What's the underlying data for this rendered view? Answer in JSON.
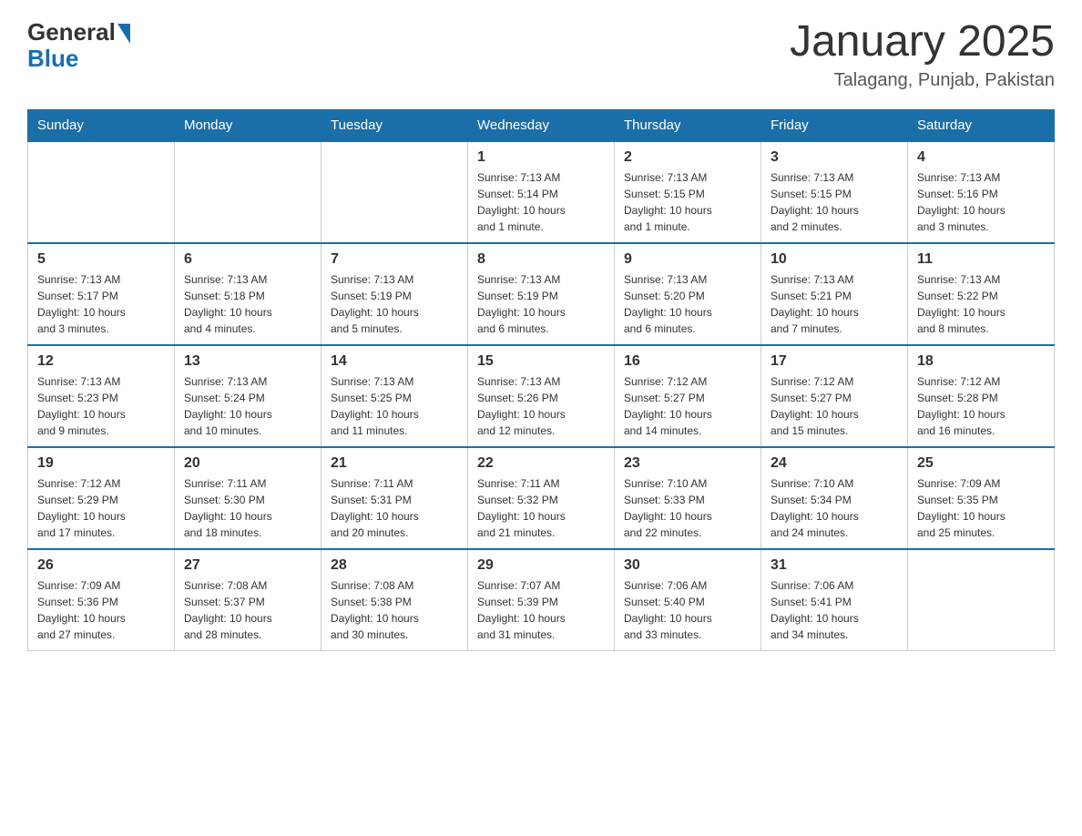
{
  "header": {
    "logo_general": "General",
    "logo_blue": "Blue",
    "month_title": "January 2025",
    "location": "Talagang, Punjab, Pakistan"
  },
  "weekdays": [
    "Sunday",
    "Monday",
    "Tuesday",
    "Wednesday",
    "Thursday",
    "Friday",
    "Saturday"
  ],
  "weeks": [
    [
      {
        "day": "",
        "info": ""
      },
      {
        "day": "",
        "info": ""
      },
      {
        "day": "",
        "info": ""
      },
      {
        "day": "1",
        "info": "Sunrise: 7:13 AM\nSunset: 5:14 PM\nDaylight: 10 hours\nand 1 minute."
      },
      {
        "day": "2",
        "info": "Sunrise: 7:13 AM\nSunset: 5:15 PM\nDaylight: 10 hours\nand 1 minute."
      },
      {
        "day": "3",
        "info": "Sunrise: 7:13 AM\nSunset: 5:15 PM\nDaylight: 10 hours\nand 2 minutes."
      },
      {
        "day": "4",
        "info": "Sunrise: 7:13 AM\nSunset: 5:16 PM\nDaylight: 10 hours\nand 3 minutes."
      }
    ],
    [
      {
        "day": "5",
        "info": "Sunrise: 7:13 AM\nSunset: 5:17 PM\nDaylight: 10 hours\nand 3 minutes."
      },
      {
        "day": "6",
        "info": "Sunrise: 7:13 AM\nSunset: 5:18 PM\nDaylight: 10 hours\nand 4 minutes."
      },
      {
        "day": "7",
        "info": "Sunrise: 7:13 AM\nSunset: 5:19 PM\nDaylight: 10 hours\nand 5 minutes."
      },
      {
        "day": "8",
        "info": "Sunrise: 7:13 AM\nSunset: 5:19 PM\nDaylight: 10 hours\nand 6 minutes."
      },
      {
        "day": "9",
        "info": "Sunrise: 7:13 AM\nSunset: 5:20 PM\nDaylight: 10 hours\nand 6 minutes."
      },
      {
        "day": "10",
        "info": "Sunrise: 7:13 AM\nSunset: 5:21 PM\nDaylight: 10 hours\nand 7 minutes."
      },
      {
        "day": "11",
        "info": "Sunrise: 7:13 AM\nSunset: 5:22 PM\nDaylight: 10 hours\nand 8 minutes."
      }
    ],
    [
      {
        "day": "12",
        "info": "Sunrise: 7:13 AM\nSunset: 5:23 PM\nDaylight: 10 hours\nand 9 minutes."
      },
      {
        "day": "13",
        "info": "Sunrise: 7:13 AM\nSunset: 5:24 PM\nDaylight: 10 hours\nand 10 minutes."
      },
      {
        "day": "14",
        "info": "Sunrise: 7:13 AM\nSunset: 5:25 PM\nDaylight: 10 hours\nand 11 minutes."
      },
      {
        "day": "15",
        "info": "Sunrise: 7:13 AM\nSunset: 5:26 PM\nDaylight: 10 hours\nand 12 minutes."
      },
      {
        "day": "16",
        "info": "Sunrise: 7:12 AM\nSunset: 5:27 PM\nDaylight: 10 hours\nand 14 minutes."
      },
      {
        "day": "17",
        "info": "Sunrise: 7:12 AM\nSunset: 5:27 PM\nDaylight: 10 hours\nand 15 minutes."
      },
      {
        "day": "18",
        "info": "Sunrise: 7:12 AM\nSunset: 5:28 PM\nDaylight: 10 hours\nand 16 minutes."
      }
    ],
    [
      {
        "day": "19",
        "info": "Sunrise: 7:12 AM\nSunset: 5:29 PM\nDaylight: 10 hours\nand 17 minutes."
      },
      {
        "day": "20",
        "info": "Sunrise: 7:11 AM\nSunset: 5:30 PM\nDaylight: 10 hours\nand 18 minutes."
      },
      {
        "day": "21",
        "info": "Sunrise: 7:11 AM\nSunset: 5:31 PM\nDaylight: 10 hours\nand 20 minutes."
      },
      {
        "day": "22",
        "info": "Sunrise: 7:11 AM\nSunset: 5:32 PM\nDaylight: 10 hours\nand 21 minutes."
      },
      {
        "day": "23",
        "info": "Sunrise: 7:10 AM\nSunset: 5:33 PM\nDaylight: 10 hours\nand 22 minutes."
      },
      {
        "day": "24",
        "info": "Sunrise: 7:10 AM\nSunset: 5:34 PM\nDaylight: 10 hours\nand 24 minutes."
      },
      {
        "day": "25",
        "info": "Sunrise: 7:09 AM\nSunset: 5:35 PM\nDaylight: 10 hours\nand 25 minutes."
      }
    ],
    [
      {
        "day": "26",
        "info": "Sunrise: 7:09 AM\nSunset: 5:36 PM\nDaylight: 10 hours\nand 27 minutes."
      },
      {
        "day": "27",
        "info": "Sunrise: 7:08 AM\nSunset: 5:37 PM\nDaylight: 10 hours\nand 28 minutes."
      },
      {
        "day": "28",
        "info": "Sunrise: 7:08 AM\nSunset: 5:38 PM\nDaylight: 10 hours\nand 30 minutes."
      },
      {
        "day": "29",
        "info": "Sunrise: 7:07 AM\nSunset: 5:39 PM\nDaylight: 10 hours\nand 31 minutes."
      },
      {
        "day": "30",
        "info": "Sunrise: 7:06 AM\nSunset: 5:40 PM\nDaylight: 10 hours\nand 33 minutes."
      },
      {
        "day": "31",
        "info": "Sunrise: 7:06 AM\nSunset: 5:41 PM\nDaylight: 10 hours\nand 34 minutes."
      },
      {
        "day": "",
        "info": ""
      }
    ]
  ]
}
